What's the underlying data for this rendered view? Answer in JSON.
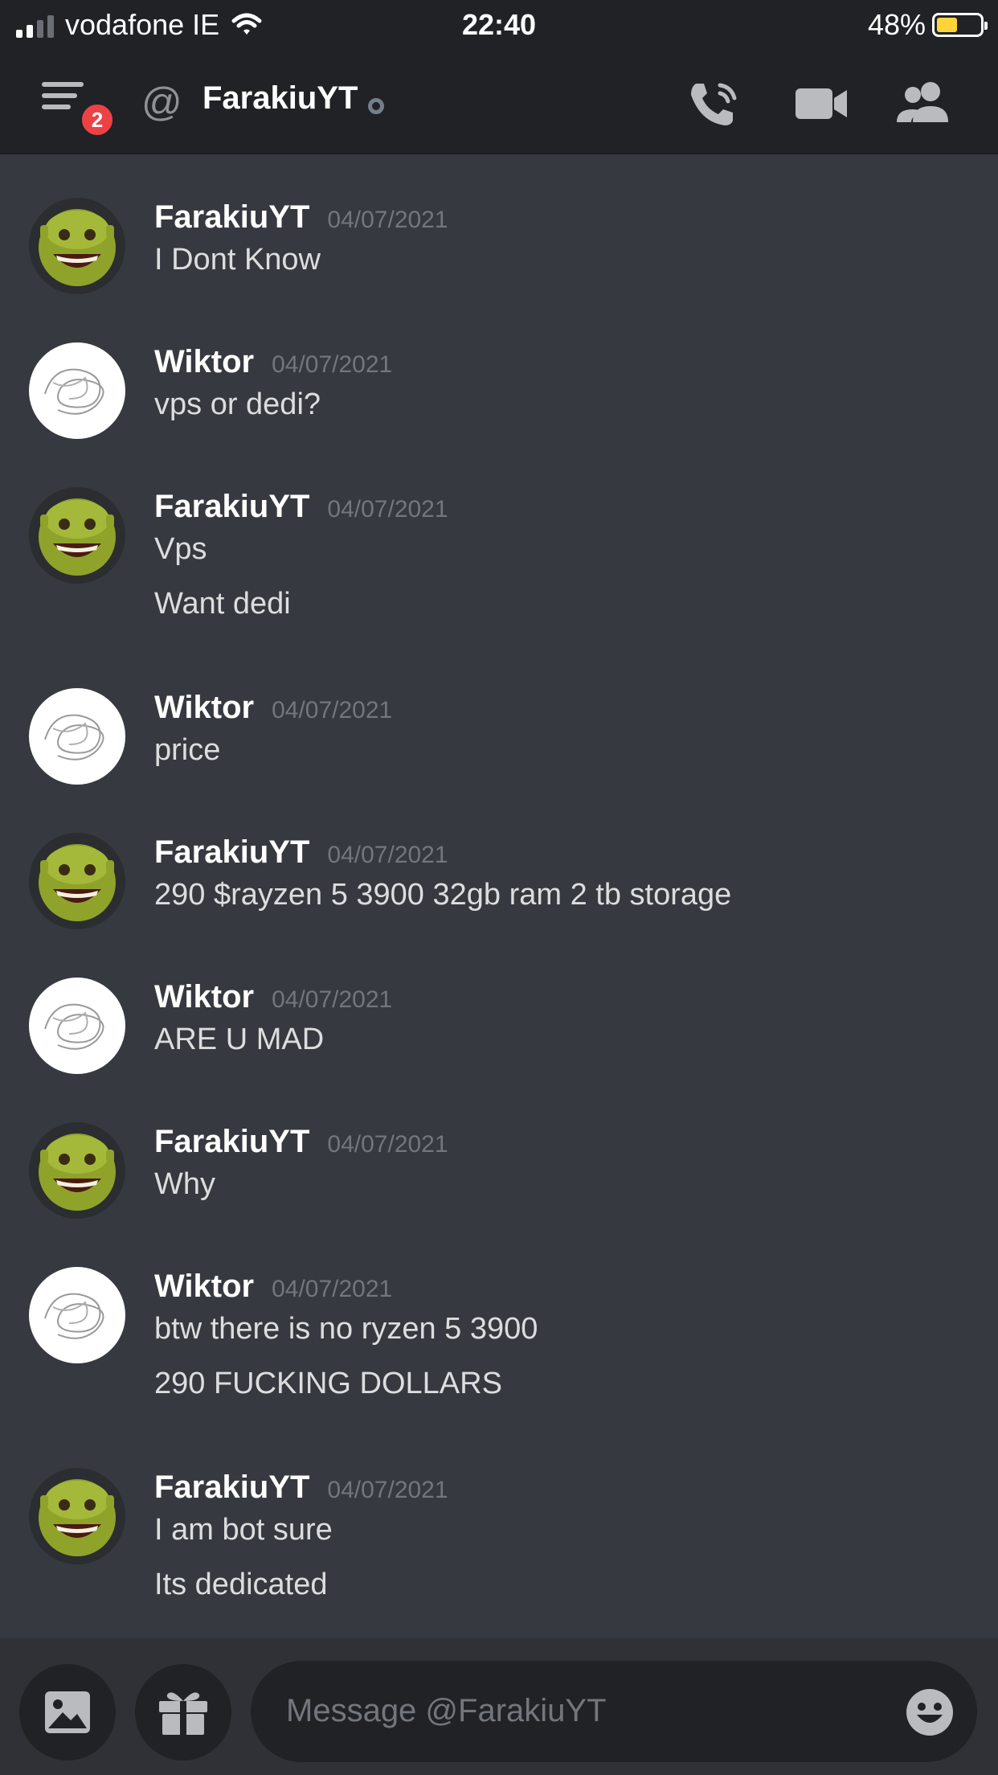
{
  "status_bar": {
    "carrier": "vodafone IE",
    "time": "22:40",
    "battery_pct": "48%",
    "battery_level": 0.48,
    "wifi_icon": "wifi-icon"
  },
  "header": {
    "menu_badge": "2",
    "at_symbol": "@",
    "title": "FarakiuYT",
    "icons": [
      "call-icon",
      "video-icon",
      "members-icon"
    ]
  },
  "messages": [
    {
      "author": "FarakiuYT",
      "timestamp": "04/07/2021",
      "lines": [
        "I Dont Know"
      ]
    },
    {
      "author": "Wiktor",
      "timestamp": "04/07/2021",
      "lines": [
        "vps or dedi?"
      ]
    },
    {
      "author": "FarakiuYT",
      "timestamp": "04/07/2021",
      "lines": [
        "Vps",
        "Want dedi"
      ]
    },
    {
      "author": "Wiktor",
      "timestamp": "04/07/2021",
      "lines": [
        "price"
      ]
    },
    {
      "author": "FarakiuYT",
      "timestamp": "04/07/2021",
      "lines": [
        "290 $rayzen 5 3900 32gb ram 2 tb storage"
      ]
    },
    {
      "author": "Wiktor",
      "timestamp": "04/07/2021",
      "lines": [
        "ARE U MAD"
      ]
    },
    {
      "author": "FarakiuYT",
      "timestamp": "04/07/2021",
      "lines": [
        "Why"
      ]
    },
    {
      "author": "Wiktor",
      "timestamp": "04/07/2021",
      "lines": [
        "btw there is no ryzen 5 3900",
        "290 FUCKING DOLLARS"
      ]
    },
    {
      "author": "FarakiuYT",
      "timestamp": "04/07/2021",
      "lines": [
        "I am bot sure",
        "Its dedicated"
      ]
    }
  ],
  "composer": {
    "placeholder": "Message @FarakiuYT",
    "icons": [
      "image-icon",
      "gift-icon",
      "emoji-icon"
    ]
  },
  "colors": {
    "background": "#36393f",
    "header": "#202225",
    "badge": "#ed4245",
    "battery": "#ffd43b"
  }
}
